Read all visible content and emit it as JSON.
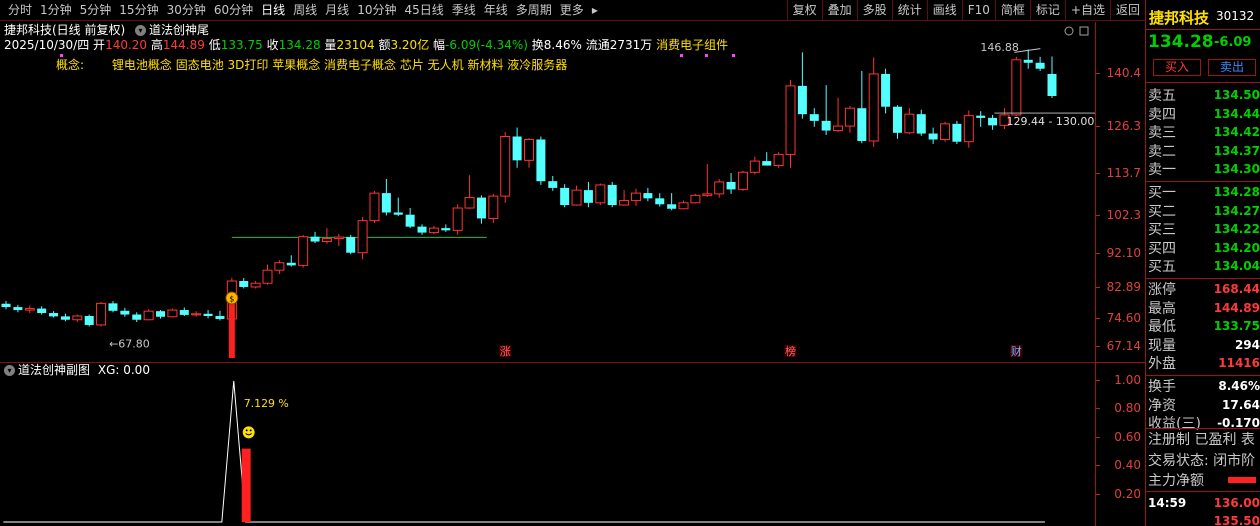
{
  "tabs": [
    "分时",
    "1分钟",
    "5分钟",
    "15分钟",
    "30分钟",
    "60分钟",
    "日线",
    "周线",
    "月线",
    "10分钟",
    "45日线",
    "季线",
    "年线",
    "多周期",
    "更多"
  ],
  "active_tab": "日线",
  "more_arrow": "▸",
  "tools": [
    "复权",
    "叠加",
    "多股",
    "统计",
    "画线",
    "F10",
    "简框",
    "标记",
    "+自选",
    "返回"
  ],
  "chart_header": {
    "stock_mode": "捷邦科技(日线 前复权)",
    "indicator": "道法创神尾",
    "date": "2025/10/30/四",
    "open_label": "开",
    "open": "140.20",
    "high_label": "高",
    "high": "144.89",
    "low_label": "低",
    "low": "133.75",
    "close_label": "收",
    "close": "134.28",
    "vol_label": "量",
    "vol": "23104",
    "amt_label": "额",
    "amt": "3.20亿",
    "chg_label": "幅",
    "chg": "-6.09(-4.34%)",
    "turn_label": "换",
    "turn": "8.46%",
    "float_label": "流通",
    "float": "2731万",
    "industry": "消费电子组件",
    "concept_label": "概念:",
    "concepts": "锂电池概念 固态电池 3D打印 苹果概念 消费电子概念 芯片 无人机 新材料 液冷服务器"
  },
  "price_labels": {
    "high_mark": "146.88",
    "low_mark": "67.80",
    "range": "129.44 - 130.00"
  },
  "axis_main": [
    "140.4",
    "126.3",
    "113.7",
    "102.3",
    "92.10",
    "82.89",
    "74.60",
    "67.14"
  ],
  "axis_sub": [
    "1.00",
    "0.80",
    "0.60",
    "0.40",
    "0.20"
  ],
  "markers": {
    "zhang": "涨",
    "bang": "榜",
    "cai": "财",
    "money_icon": "$"
  },
  "sub_chart": {
    "title": "道法创神副图",
    "xg_label": "XG:",
    "xg": "0.00",
    "pct": "7.129",
    "pct_sym": "%"
  },
  "colors": {
    "up": "#ff3232",
    "down": "#54ffff",
    "bg": "#000000",
    "grid": "#9a1616"
  },
  "chart_data": {
    "type": "candlestick",
    "candles": [
      [
        78.5,
        79.2,
        77.0,
        77.6
      ],
      [
        77.6,
        78.2,
        76.2,
        76.8
      ],
      [
        76.8,
        78.0,
        76.0,
        77.2
      ],
      [
        77.2,
        77.8,
        75.6,
        76.0
      ],
      [
        76.0,
        76.5,
        74.8,
        75.1
      ],
      [
        75.1,
        75.8,
        73.8,
        74.2
      ],
      [
        74.2,
        75.6,
        73.6,
        75.2
      ],
      [
        75.2,
        75.6,
        72.4,
        72.8
      ],
      [
        72.8,
        79.0,
        72.4,
        78.6
      ],
      [
        78.6,
        79.2,
        76.2,
        76.6
      ],
      [
        76.6,
        77.4,
        75.0,
        75.6
      ],
      [
        75.6,
        76.2,
        73.6,
        74.2
      ],
      [
        74.2,
        77.0,
        74.0,
        76.5
      ],
      [
        76.5,
        76.8,
        74.5,
        75.0
      ],
      [
        75.0,
        77.2,
        74.8,
        76.8
      ],
      [
        76.8,
        77.5,
        75.2,
        75.5
      ],
      [
        75.5,
        76.5,
        75.0,
        75.8
      ],
      [
        75.8,
        76.8,
        74.6,
        75.2
      ],
      [
        75.2,
        76.6,
        74.0,
        74.4
      ],
      [
        74.4,
        85.4,
        74.0,
        84.6
      ],
      [
        84.6,
        85.4,
        82.6,
        83.0
      ],
      [
        83.0,
        84.6,
        82.6,
        84.0
      ],
      [
        84.0,
        89.0,
        83.6,
        87.5
      ],
      [
        87.5,
        90.2,
        86.5,
        89.5
      ],
      [
        89.5,
        91.5,
        88.5,
        88.8
      ],
      [
        88.8,
        97.0,
        88.2,
        96.5
      ],
      [
        96.5,
        97.8,
        94.8,
        95.2
      ],
      [
        95.2,
        98.8,
        94.6,
        96.0
      ],
      [
        96.0,
        97.2,
        94.0,
        96.4
      ],
      [
        96.4,
        97.0,
        91.8,
        92.2
      ],
      [
        92.2,
        101.8,
        90.4,
        100.8
      ],
      [
        100.8,
        108.8,
        100.2,
        108.2
      ],
      [
        108.2,
        112.0,
        102.2,
        103.0
      ],
      [
        103.0,
        107.0,
        102.0,
        102.4
      ],
      [
        102.4,
        104.2,
        98.8,
        99.2
      ],
      [
        99.2,
        99.8,
        97.0,
        97.6
      ],
      [
        97.6,
        99.4,
        97.2,
        98.8
      ],
      [
        98.8,
        99.8,
        97.8,
        98.2
      ],
      [
        98.2,
        105.2,
        97.0,
        104.2
      ],
      [
        104.2,
        113.0,
        104.0,
        107.0
      ],
      [
        107.0,
        107.6,
        100.0,
        101.4
      ],
      [
        101.4,
        108.0,
        100.2,
        107.4
      ],
      [
        107.4,
        124.6,
        105.6,
        123.4
      ],
      [
        123.4,
        125.8,
        115.0,
        117.0
      ],
      [
        117.0,
        123.0,
        115.0,
        122.6
      ],
      [
        122.6,
        123.4,
        110.4,
        111.4
      ],
      [
        111.4,
        112.8,
        108.8,
        109.6
      ],
      [
        109.6,
        110.6,
        104.4,
        105.0
      ],
      [
        105.0,
        110.2,
        104.8,
        109.0
      ],
      [
        109.0,
        111.2,
        104.4,
        105.6
      ],
      [
        105.6,
        110.8,
        105.0,
        110.4
      ],
      [
        110.4,
        111.2,
        104.4,
        105.0
      ],
      [
        105.0,
        109.0,
        104.8,
        106.2
      ],
      [
        106.2,
        109.4,
        104.8,
        108.2
      ],
      [
        108.2,
        109.6,
        106.0,
        106.8
      ],
      [
        106.8,
        108.2,
        104.6,
        105.2
      ],
      [
        105.2,
        108.2,
        103.6,
        104.0
      ],
      [
        104.0,
        106.2,
        103.8,
        105.6
      ],
      [
        105.6,
        108.0,
        105.4,
        107.6
      ],
      [
        107.6,
        116.0,
        107.2,
        108.0
      ],
      [
        108.0,
        112.0,
        107.0,
        111.2
      ],
      [
        111.2,
        113.6,
        108.0,
        109.2
      ],
      [
        109.2,
        114.2,
        108.8,
        113.8
      ],
      [
        113.8,
        118.0,
        113.2,
        116.8
      ],
      [
        116.8,
        119.2,
        115.6,
        115.6
      ],
      [
        115.6,
        119.2,
        115.0,
        118.6
      ],
      [
        118.6,
        138.6,
        115.0,
        137.0
      ],
      [
        137.0,
        146.0,
        128.2,
        129.4
      ],
      [
        129.4,
        131.0,
        126.0,
        127.6
      ],
      [
        127.6,
        137.2,
        123.8,
        125.0
      ],
      [
        125.0,
        133.8,
        124.6,
        126.2
      ],
      [
        126.2,
        131.6,
        124.4,
        131.0
      ],
      [
        131.0,
        141.0,
        121.6,
        122.2
      ],
      [
        122.2,
        144.6,
        120.6,
        140.2
      ],
      [
        140.2,
        141.6,
        129.6,
        131.4
      ],
      [
        131.4,
        131.8,
        122.8,
        124.4
      ],
      [
        124.4,
        131.0,
        124.0,
        129.4
      ],
      [
        129.4,
        130.6,
        123.6,
        124.2
      ],
      [
        124.2,
        125.8,
        121.4,
        122.6
      ],
      [
        122.6,
        127.4,
        122.0,
        126.8
      ],
      [
        126.8,
        127.6,
        121.4,
        122.0
      ],
      [
        122.0,
        130.4,
        120.4,
        129.0
      ],
      [
        129.0,
        130.2,
        126.0,
        128.4
      ],
      [
        128.4,
        129.2,
        125.2,
        126.4
      ],
      [
        126.4,
        131.0,
        125.4,
        129.2
      ],
      [
        129.2,
        144.8,
        128.8,
        144.0
      ],
      [
        144.0,
        146.8,
        141.6,
        143.2
      ],
      [
        143.2,
        144.8,
        141.0,
        141.6
      ],
      [
        140.2,
        144.89,
        133.75,
        134.28
      ]
    ],
    "ma_line_value": 96.3,
    "signal_index": 19,
    "sub_series": {
      "signal_index": 19,
      "peak": 1.0,
      "bar": 0.52
    },
    "ylim": [
      65.0,
      152.0
    ]
  }
}
